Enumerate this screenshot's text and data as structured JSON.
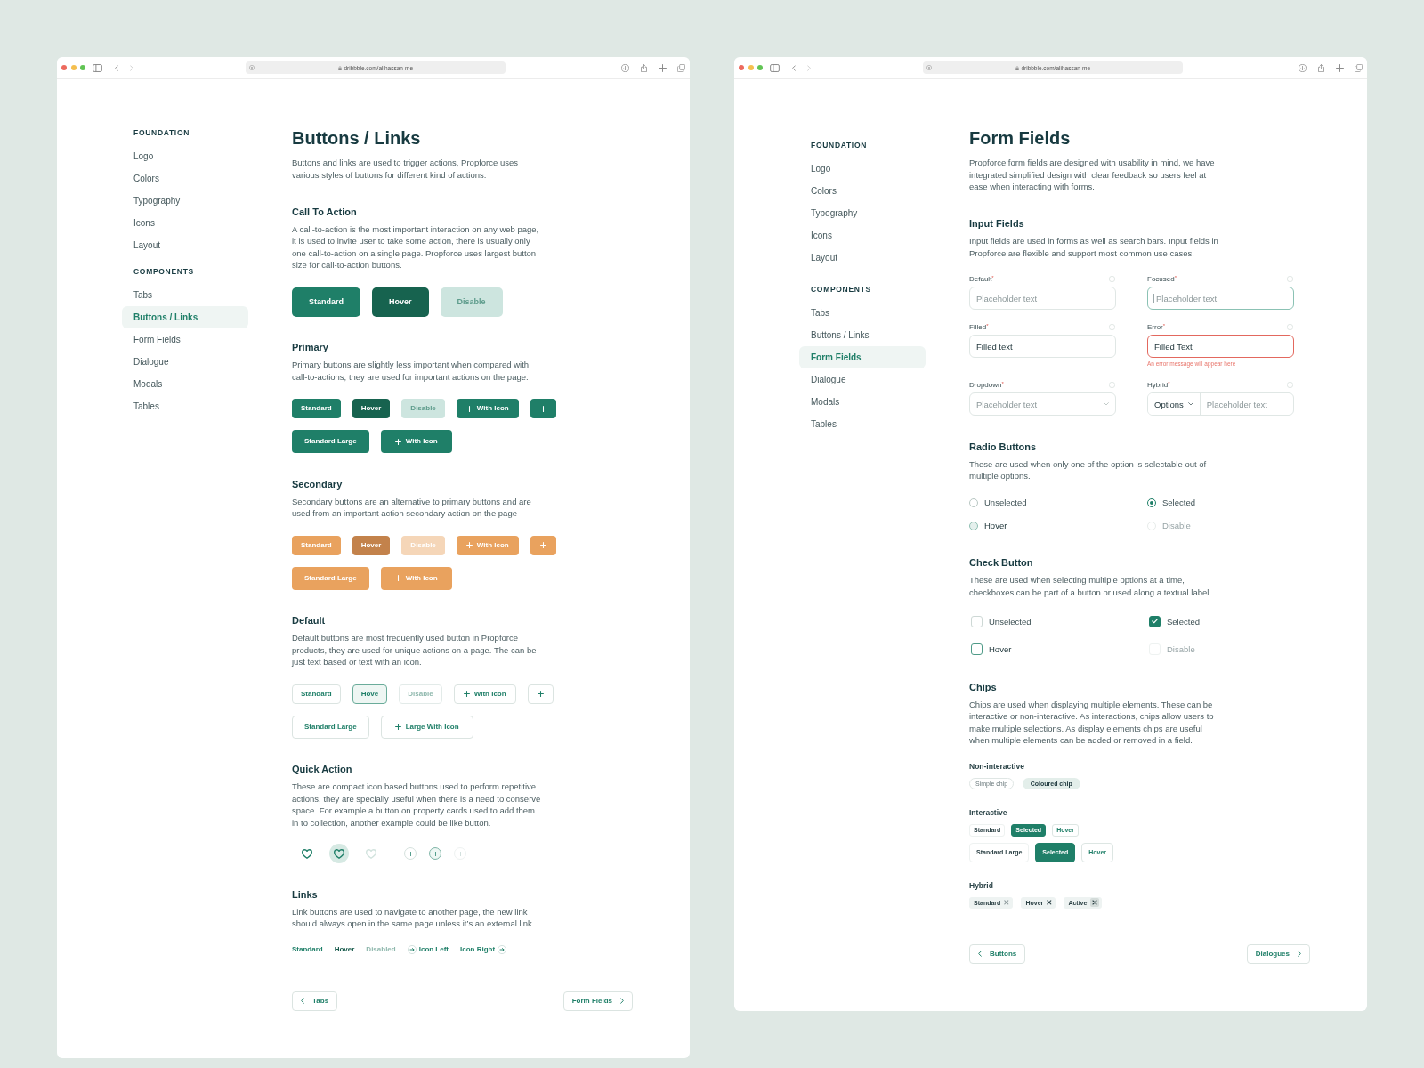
{
  "windows": [
    {
      "browser": {
        "url": "dribbble.com/alihassan-me"
      },
      "sidebar": [
        {
          "title": "FOUNDATION",
          "items": [
            {
              "label": "Logo",
              "selected": false
            },
            {
              "label": "Colors",
              "selected": false
            },
            {
              "label": "Typography",
              "selected": false
            },
            {
              "label": "Icons",
              "selected": false
            },
            {
              "label": "Layout",
              "selected": false
            }
          ]
        },
        {
          "title": "COMPONENTS",
          "items": [
            {
              "label": "Tabs",
              "selected": false
            },
            {
              "label": "Buttons / Links",
              "selected": true
            },
            {
              "label": "Form Fields",
              "selected": false
            },
            {
              "label": "Dialogue",
              "selected": false
            },
            {
              "label": "Modals",
              "selected": false
            },
            {
              "label": "Tables",
              "selected": false
            }
          ]
        }
      ],
      "page": {
        "title": "Buttons / Links",
        "description": "Buttons and links are used to trigger actions, Propforce uses various styles of buttons for different kind of actions.",
        "sections": [
          {
            "kind": "cta",
            "heading": "Call To Action",
            "description": "A call-to-action is the most important interaction on any web page, it is used to invite user to take some action, there is usually only one call-to-action on a single page. Propforce uses largest button size for call-to-action buttons.",
            "rows": [
              {
                "buttons": [
                  {
                    "label": "Standard",
                    "kind": "text",
                    "hovered": false,
                    "disabled": false
                  },
                  {
                    "label": "Hover",
                    "kind": "text",
                    "hovered": true,
                    "disabled": false
                  },
                  {
                    "label": "Disable",
                    "kind": "text",
                    "hovered": false,
                    "disabled": true
                  }
                ]
              }
            ]
          },
          {
            "kind": "primary_buttons",
            "heading": "Primary",
            "description": "Primary buttons are slightly less important when compared with call-to-actions, they are used for important actions on the page.",
            "rows": [
              {
                "buttons": [
                  {
                    "label": "Standard",
                    "kind": "text",
                    "hovered": false,
                    "disabled": false
                  },
                  {
                    "label": "Hover",
                    "kind": "text",
                    "hovered": true,
                    "disabled": false
                  },
                  {
                    "label": "Disable",
                    "kind": "text",
                    "hovered": false,
                    "disabled": true
                  },
                  {
                    "label": "With Icon",
                    "kind": "icon_text",
                    "hovered": false,
                    "disabled": false
                  },
                  {
                    "kind": "icon",
                    "hovered": false,
                    "disabled": false
                  }
                ]
              },
              {
                "buttons": [
                  {
                    "label": "Standard Large",
                    "kind": "text",
                    "hovered": false,
                    "disabled": false
                  },
                  {
                    "label": "With Icon",
                    "kind": "icon_text",
                    "hovered": false,
                    "disabled": false
                  }
                ]
              }
            ]
          },
          {
            "kind": "secondary_buttons",
            "heading": "Secondary",
            "description": "Secondary buttons are an alternative to primary buttons and are used from an important action secondary action on the page",
            "rows": [
              {
                "buttons": [
                  {
                    "label": "Standard",
                    "kind": "text",
                    "hovered": false,
                    "disabled": false
                  },
                  {
                    "label": "Hover",
                    "kind": "text",
                    "hovered": true,
                    "disabled": false
                  },
                  {
                    "label": "Disable",
                    "kind": "text",
                    "hovered": false,
                    "disabled": true
                  },
                  {
                    "label": "With Icon",
                    "kind": "icon_text",
                    "hovered": false,
                    "disabled": false
                  },
                  {
                    "kind": "icon",
                    "hovered": false,
                    "disabled": false
                  }
                ]
              },
              {
                "buttons": [
                  {
                    "label": "Standard Large",
                    "kind": "text",
                    "hovered": false,
                    "disabled": false
                  },
                  {
                    "label": "With Icon",
                    "kind": "icon_text",
                    "hovered": false,
                    "disabled": false
                  }
                ]
              }
            ]
          },
          {
            "kind": "default_buttons",
            "heading": "Default",
            "description": "Default buttons are most frequently used button in Propforce products, they are used for unique actions on a page. The can be just text based or text with an icon.",
            "rows": [
              {
                "buttons": [
                  {
                    "label": "Standard",
                    "kind": "text",
                    "hovered": false,
                    "disabled": false
                  },
                  {
                    "label": "Hove",
                    "kind": "text",
                    "hovered": true,
                    "disabled": false
                  },
                  {
                    "label": "Disable",
                    "kind": "text",
                    "hovered": false,
                    "disabled": true
                  },
                  {
                    "label": "With Icon",
                    "kind": "icon_text",
                    "hovered": false,
                    "disabled": false
                  },
                  {
                    "kind": "icon",
                    "hovered": false,
                    "disabled": false
                  }
                ]
              },
              {
                "buttons": [
                  {
                    "label": "Standard Large",
                    "kind": "text",
                    "hovered": false,
                    "disabled": false
                  },
                  {
                    "label": "Large With Icon",
                    "kind": "icon_text",
                    "hovered": false,
                    "disabled": false
                  }
                ]
              }
            ]
          },
          {
            "kind": "quick_actions",
            "heading": "Quick Action",
            "description": "These are compact icon based buttons used to perform repetitive actions, they are specially useful when there is a need to conserve space. For example a button on property cards used to add them in to collection, another example could be like button.",
            "buttons": [
              {
                "kind": "favorite",
                "hovered": false,
                "disabled": false
              },
              {
                "kind": "favorite",
                "hovered": true,
                "disabled": false
              },
              {
                "kind": "favorite",
                "hovered": false,
                "disabled": true
              },
              {
                "kind": "add",
                "hovered": false,
                "disabled": false
              },
              {
                "kind": "add",
                "hovered": true,
                "disabled": false
              },
              {
                "kind": "add",
                "hovered": false,
                "disabled": true
              }
            ]
          },
          {
            "kind": "links",
            "heading": "Links",
            "description": "Link buttons are used to navigate to another page, the new link should always open in the same page unless it’s an external link.",
            "links": [
              {
                "label": "Standard",
                "kind": "text",
                "hovered": false,
                "disabled": false
              },
              {
                "label": "Hover",
                "kind": "text",
                "hovered": true,
                "disabled": false
              },
              {
                "label": "Disabled",
                "kind": "text",
                "hovered": false,
                "disabled": true
              },
              {
                "label": "Icon Left",
                "kind": "icon_left",
                "hovered": false,
                "disabled": false
              },
              {
                "label": "Icon Right",
                "kind": "icon_right",
                "hovered": false,
                "disabled": false
              }
            ]
          }
        ]
      },
      "pager": {
        "previous": "Tabs",
        "next": "Form Fields"
      }
    },
    {
      "browser": {
        "url": "dribbble.com/alihassan-me"
      },
      "sidebar": [
        {
          "title": "FOUNDATION",
          "items": [
            {
              "label": "Logo",
              "selected": false
            },
            {
              "label": "Colors",
              "selected": false
            },
            {
              "label": "Typography",
              "selected": false
            },
            {
              "label": "Icons",
              "selected": false
            },
            {
              "label": "Layout",
              "selected": false
            }
          ]
        },
        {
          "title": "COMPONENTS",
          "items": [
            {
              "label": "Tabs",
              "selected": false
            },
            {
              "label": "Buttons / Links",
              "selected": false
            },
            {
              "label": "Form Fields",
              "selected": true
            },
            {
              "label": "Dialogue",
              "selected": false
            },
            {
              "label": "Modals",
              "selected": false
            },
            {
              "label": "Tables",
              "selected": false
            }
          ]
        }
      ],
      "page": {
        "title": "Form Fields",
        "description": "Propforce form fields are designed with usability in mind, we have integrated simplified design with clear feedback so users feel at ease when interacting with forms.",
        "sections": [
          {
            "kind": "inputs",
            "heading": "Input Fields",
            "description": "Input fields are used in forms as well as search bars. Input fields in Propforce are flexible and support most common use cases.",
            "fields": [
              {
                "kind": "text",
                "label": "Default$^{*}$",
                "placeholder": "Placeholder text",
                "focused": false,
                "error": false
              },
              {
                "kind": "text",
                "label": "Focused$^{*}$",
                "placeholder": "Placeholder text",
                "focused": true,
                "error": false
              },
              {
                "kind": "text",
                "label": "Filled$^{*}$",
                "value": "Filled text",
                "focused": false,
                "error": false
              },
              {
                "kind": "text",
                "label": "Error$^{*}$",
                "value": "Filled Text",
                "focused": false,
                "error": true,
                "error_message": "An error message will appear here"
              },
              {
                "kind": "dropdown",
                "label": "Dropdown$^{*}$",
                "placeholder": "Placeholder text",
                "focused": false,
                "error": false
              },
              {
                "kind": "hybrid",
                "label": "Hybrid$^{*}$",
                "option": "Options",
                "placeholder": "Placeholder text",
                "focused": false,
                "error": false
              }
            ]
          },
          {
            "kind": "radios",
            "heading": "Radio Buttons",
            "description": "These are used when only one of the option is selectable out of multiple options.",
            "options": [
              {
                "label": "Unselected",
                "selected": false,
                "hovered": false,
                "disabled": false
              },
              {
                "label": "Selected",
                "selected": true,
                "hovered": false,
                "disabled": false
              },
              {
                "label": "Hover",
                "selected": false,
                "hovered": true,
                "disabled": false
              },
              {
                "label": "Disable",
                "selected": false,
                "hovered": false,
                "disabled": true
              }
            ]
          },
          {
            "kind": "checkboxes",
            "heading": "Check Button",
            "description": "These are used when selecting multiple options at a time, checkboxes can be part of a button or used along a textual label.",
            "options": [
              {
                "label": "Unselected",
                "checked": false,
                "hovered": false,
                "disabled": false
              },
              {
                "label": "Selected",
                "checked": true,
                "hovered": false,
                "disabled": false
              },
              {
                "label": "Hover",
                "checked": false,
                "hovered": true,
                "disabled": false
              },
              {
                "label": "Disable",
                "checked": false,
                "hovered": false,
                "disabled": true
              }
            ]
          },
          {
            "kind": "chips",
            "heading": "Chips",
            "description": "Chips are used when displaying multiple elements. These can be interactive or non-interactive. As interactions, chips allow users to make multiple selections. As display elements chips are useful when multiple elements can be added or removed in a field.",
            "groups": [
              {
                "kind": "static",
                "label": "Non-interactive",
                "rows": [
                  {
                    "chips": [
                      {
                        "label": "Simple chip",
                        "kind": "simple"
                      },
                      {
                        "label": "Coloured chip",
                        "kind": "coloured"
                      }
                    ]
                  }
                ]
              },
              {
                "kind": "selectable",
                "label": "Interactive",
                "rows": [
                  {
                    "chips": [
                      {
                        "label": "Standard",
                        "selected": false,
                        "hovered": false
                      },
                      {
                        "label": "Selected",
                        "selected": true,
                        "hovered": false
                      },
                      {
                        "label": "Hover",
                        "selected": false,
                        "hovered": true
                      }
                    ]
                  },
                  {
                    "chips": [
                      {
                        "label": "Standard Large",
                        "selected": false,
                        "hovered": false
                      },
                      {
                        "label": "Selected",
                        "selected": true,
                        "hovered": false
                      },
                      {
                        "label": "Hover",
                        "selected": false,
                        "hovered": true
                      }
                    ]
                  }
                ]
              },
              {
                "kind": "removable",
                "label": "Hybrid",
                "rows": [
                  {
                    "chips": [
                      {
                        "label": "Standard",
                        "hovered": false,
                        "active": false
                      },
                      {
                        "label": "Hover",
                        "hovered": true,
                        "active": false
                      },
                      {
                        "label": "Active",
                        "hovered": false,
                        "active": true
                      }
                    ]
                  }
                ]
              }
            ]
          }
        ]
      },
      "pager": {
        "previous": "Buttons",
        "next": "Dialogues"
      }
    }
  ]
}
